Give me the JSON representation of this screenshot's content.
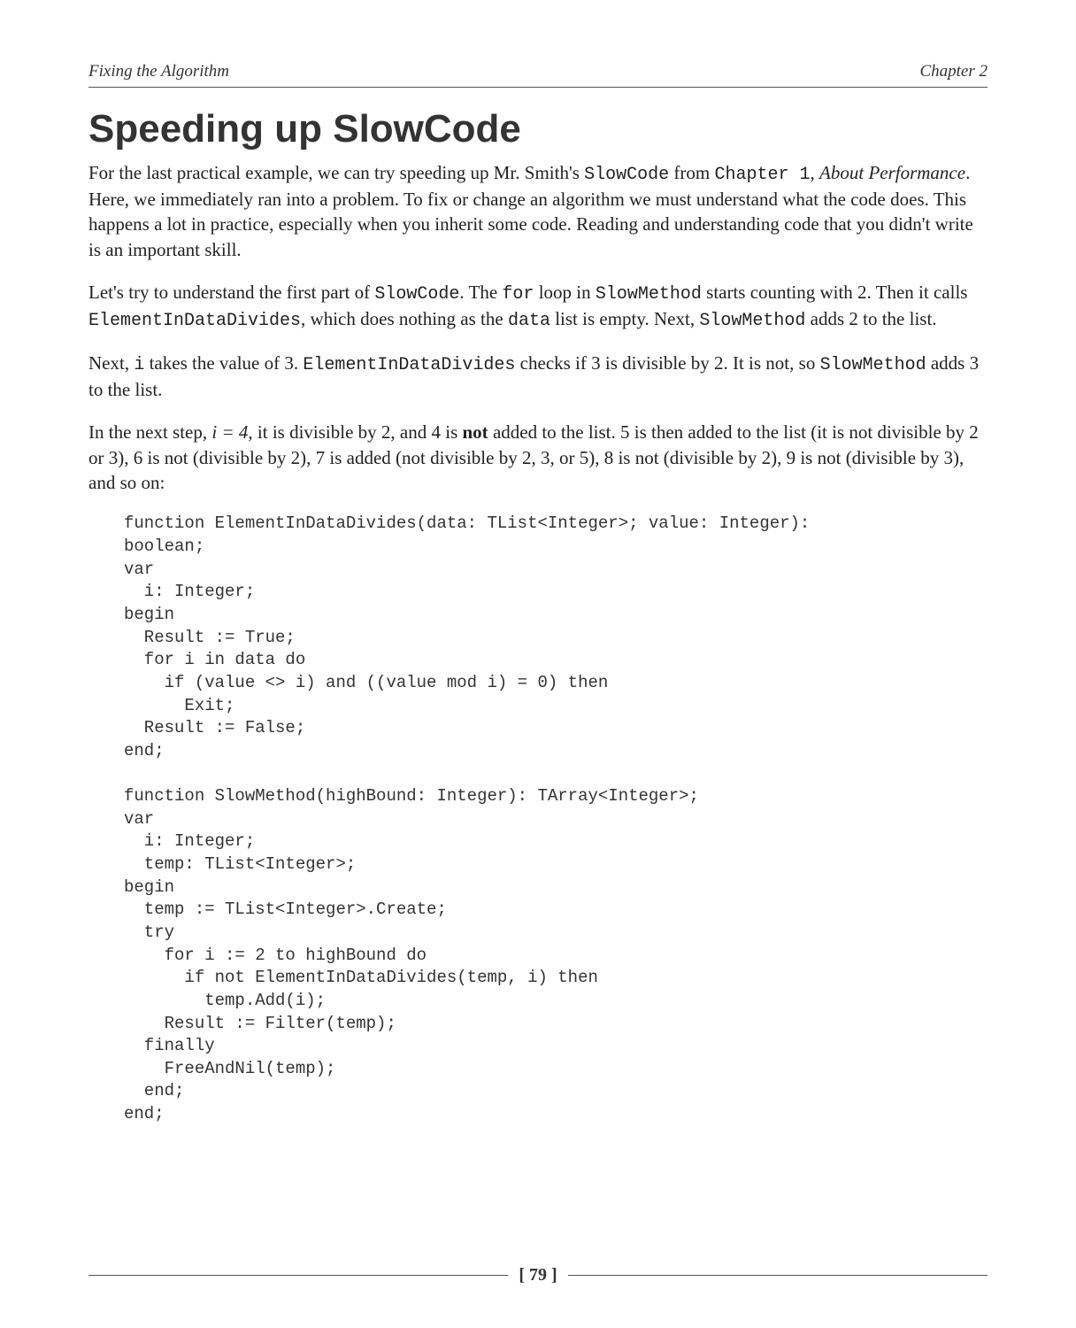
{
  "header": {
    "left": "Fixing the Algorithm",
    "right": "Chapter 2"
  },
  "title": "Speeding up SlowCode",
  "p1": {
    "t1": "For the last practical example, we can try speeding up Mr. Smith's ",
    "c1": "SlowCode",
    "t2": " from ",
    "c2": "Chapter 1",
    "t3": ", ",
    "i1": "About Performance",
    "t4": ". Here, we immediately ran into a problem. To fix or change an algorithm we must understand what the code does. This happens a lot in practice, especially when you inherit some code. Reading and understanding code that you didn't write is an important skill."
  },
  "p2": {
    "t1": "Let's try to understand the first part of ",
    "c1": "SlowCode",
    "t2": ". The ",
    "c2": "for",
    "t3": " loop in ",
    "c3": "SlowMethod",
    "t4": " starts counting with 2. Then it calls ",
    "c4": "ElementInDataDivides",
    "t5": ", which does nothing as the ",
    "c5": "data",
    "t6": " list is empty. Next, ",
    "c6": "SlowMethod",
    "t7": " adds 2 to the list."
  },
  "p3": {
    "t1": "Next, ",
    "c1": "i",
    "t2": " takes the value of 3. ",
    "c2": "ElementInDataDivides",
    "t3": " checks if 3 is divisible by 2. It is not, so ",
    "c3": "SlowMethod",
    "t4": " adds 3 to the list."
  },
  "p4": {
    "t1": "In the next step, ",
    "i1": "i = 4",
    "t2": ", it is divisible by 2, and 4 is ",
    "b1": "not",
    "t3": " added to the list. 5 is then added to the list (it is not divisible by 2 or 3), 6 is not (divisible by 2), 7 is added (not divisible by 2, 3, or 5), 8 is not (divisible by 2), 9 is not (divisible by 3), and so on:"
  },
  "code": "function ElementInDataDivides(data: TList<Integer>; value: Integer):\nboolean;\nvar\n  i: Integer;\nbegin\n  Result := True;\n  for i in data do\n    if (value <> i) and ((value mod i) = 0) then\n      Exit;\n  Result := False;\nend;\n\nfunction SlowMethod(highBound: Integer): TArray<Integer>;\nvar\n  i: Integer;\n  temp: TList<Integer>;\nbegin\n  temp := TList<Integer>.Create;\n  try\n    for i := 2 to highBound do\n      if not ElementInDataDivides(temp, i) then\n        temp.Add(i);\n    Result := Filter(temp);\n  finally\n    FreeAndNil(temp);\n  end;\nend;",
  "footer": {
    "page": "[ 79 ]"
  }
}
